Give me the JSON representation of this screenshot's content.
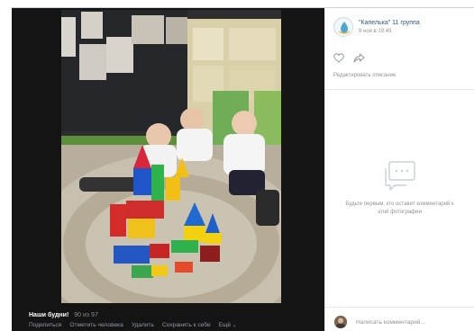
{
  "viewer": {
    "caption_title": "Наши будни!",
    "counter": "90 из 97",
    "actions": {
      "share": "Поделиться",
      "tag": "Отметить человека",
      "delete": "Удалить",
      "save": "Сохранить к себе",
      "more": "Ещё"
    }
  },
  "panel": {
    "author_name": "\"Капелька\" 11 группа",
    "date": "9 ноя в 19:49",
    "edit_description": "Редактировать описание",
    "empty_text": "Будьте первым, кто оставит комментарий к этой фотографии",
    "comment_placeholder": "Написать комментарий..."
  },
  "icons": {
    "like": "heart-icon",
    "share": "share-arrow-icon",
    "empty": "comments-icon"
  },
  "colors": {
    "link": "#2a5885",
    "muted": "#939393",
    "viewer_bg": "#141414",
    "action_text": "#8c9aa8"
  }
}
